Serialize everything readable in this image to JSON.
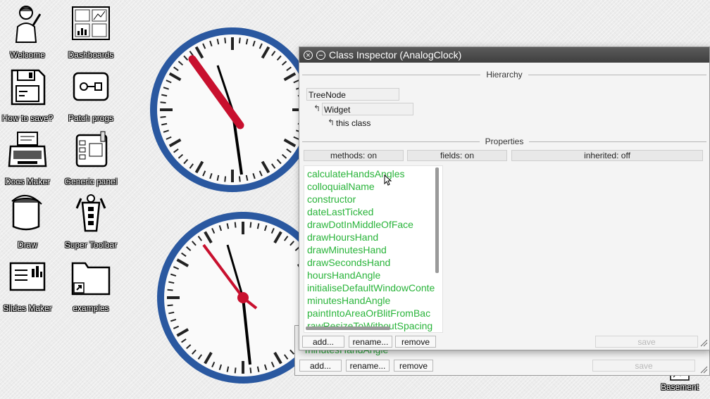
{
  "desktop_icons": [
    {
      "label": "Welcome",
      "icon": "welcome-person-icon"
    },
    {
      "label": "Dashboards",
      "icon": "dashboards-icon"
    },
    {
      "label": "How to save?",
      "icon": "floppy-disk-icon"
    },
    {
      "label": "Patch progs",
      "icon": "patch-program-icon"
    },
    {
      "label": "Docs Maker",
      "icon": "typewriter-icon"
    },
    {
      "label": "Generic panel",
      "icon": "generic-panel-icon"
    },
    {
      "label": "Draw",
      "icon": "paint-bucket-icon"
    },
    {
      "label": "Super Toolbar",
      "icon": "super-toolbar-icon"
    },
    {
      "label": "Slides Maker",
      "icon": "slides-maker-icon"
    },
    {
      "label": "examples",
      "icon": "folder-shortcut-icon"
    },
    {
      "label": "Basement",
      "icon": "basement-icon"
    }
  ],
  "window": {
    "title": "Class Inspector (AnalogClock)",
    "hierarchy_label": "Hierarchy",
    "hierarchy": [
      "TreeNode",
      "Widget",
      "this class"
    ],
    "properties_label": "Properties",
    "toggles": {
      "methods": "methods: on",
      "fields": "fields: on",
      "inherited": "inherited: off"
    },
    "methods": [
      "calculateHandsAngles",
      "colloquialName",
      "constructor",
      "dateLastTicked",
      "drawDotInMiddleOfFace",
      "drawHoursHand",
      "drawMinutesHand",
      "drawSecondsHand",
      "hoursHandAngle",
      "initialiseDefaultWindowConte",
      "minutesHandAngle",
      "paintIntoAreaOrBlitFromBac",
      "rawResizeToWithoutSpacing"
    ],
    "buttons": {
      "add": "add...",
      "rename": "rename...",
      "remove": "remove",
      "save": "save"
    }
  },
  "back_window": {
    "partial_item": "minutesHandAngle",
    "buttons": {
      "add": "add...",
      "rename": "rename...",
      "remove": "remove",
      "save": "save"
    }
  },
  "clock_colors": {
    "rim": "#2a58a0",
    "hand": "#c8102e"
  }
}
